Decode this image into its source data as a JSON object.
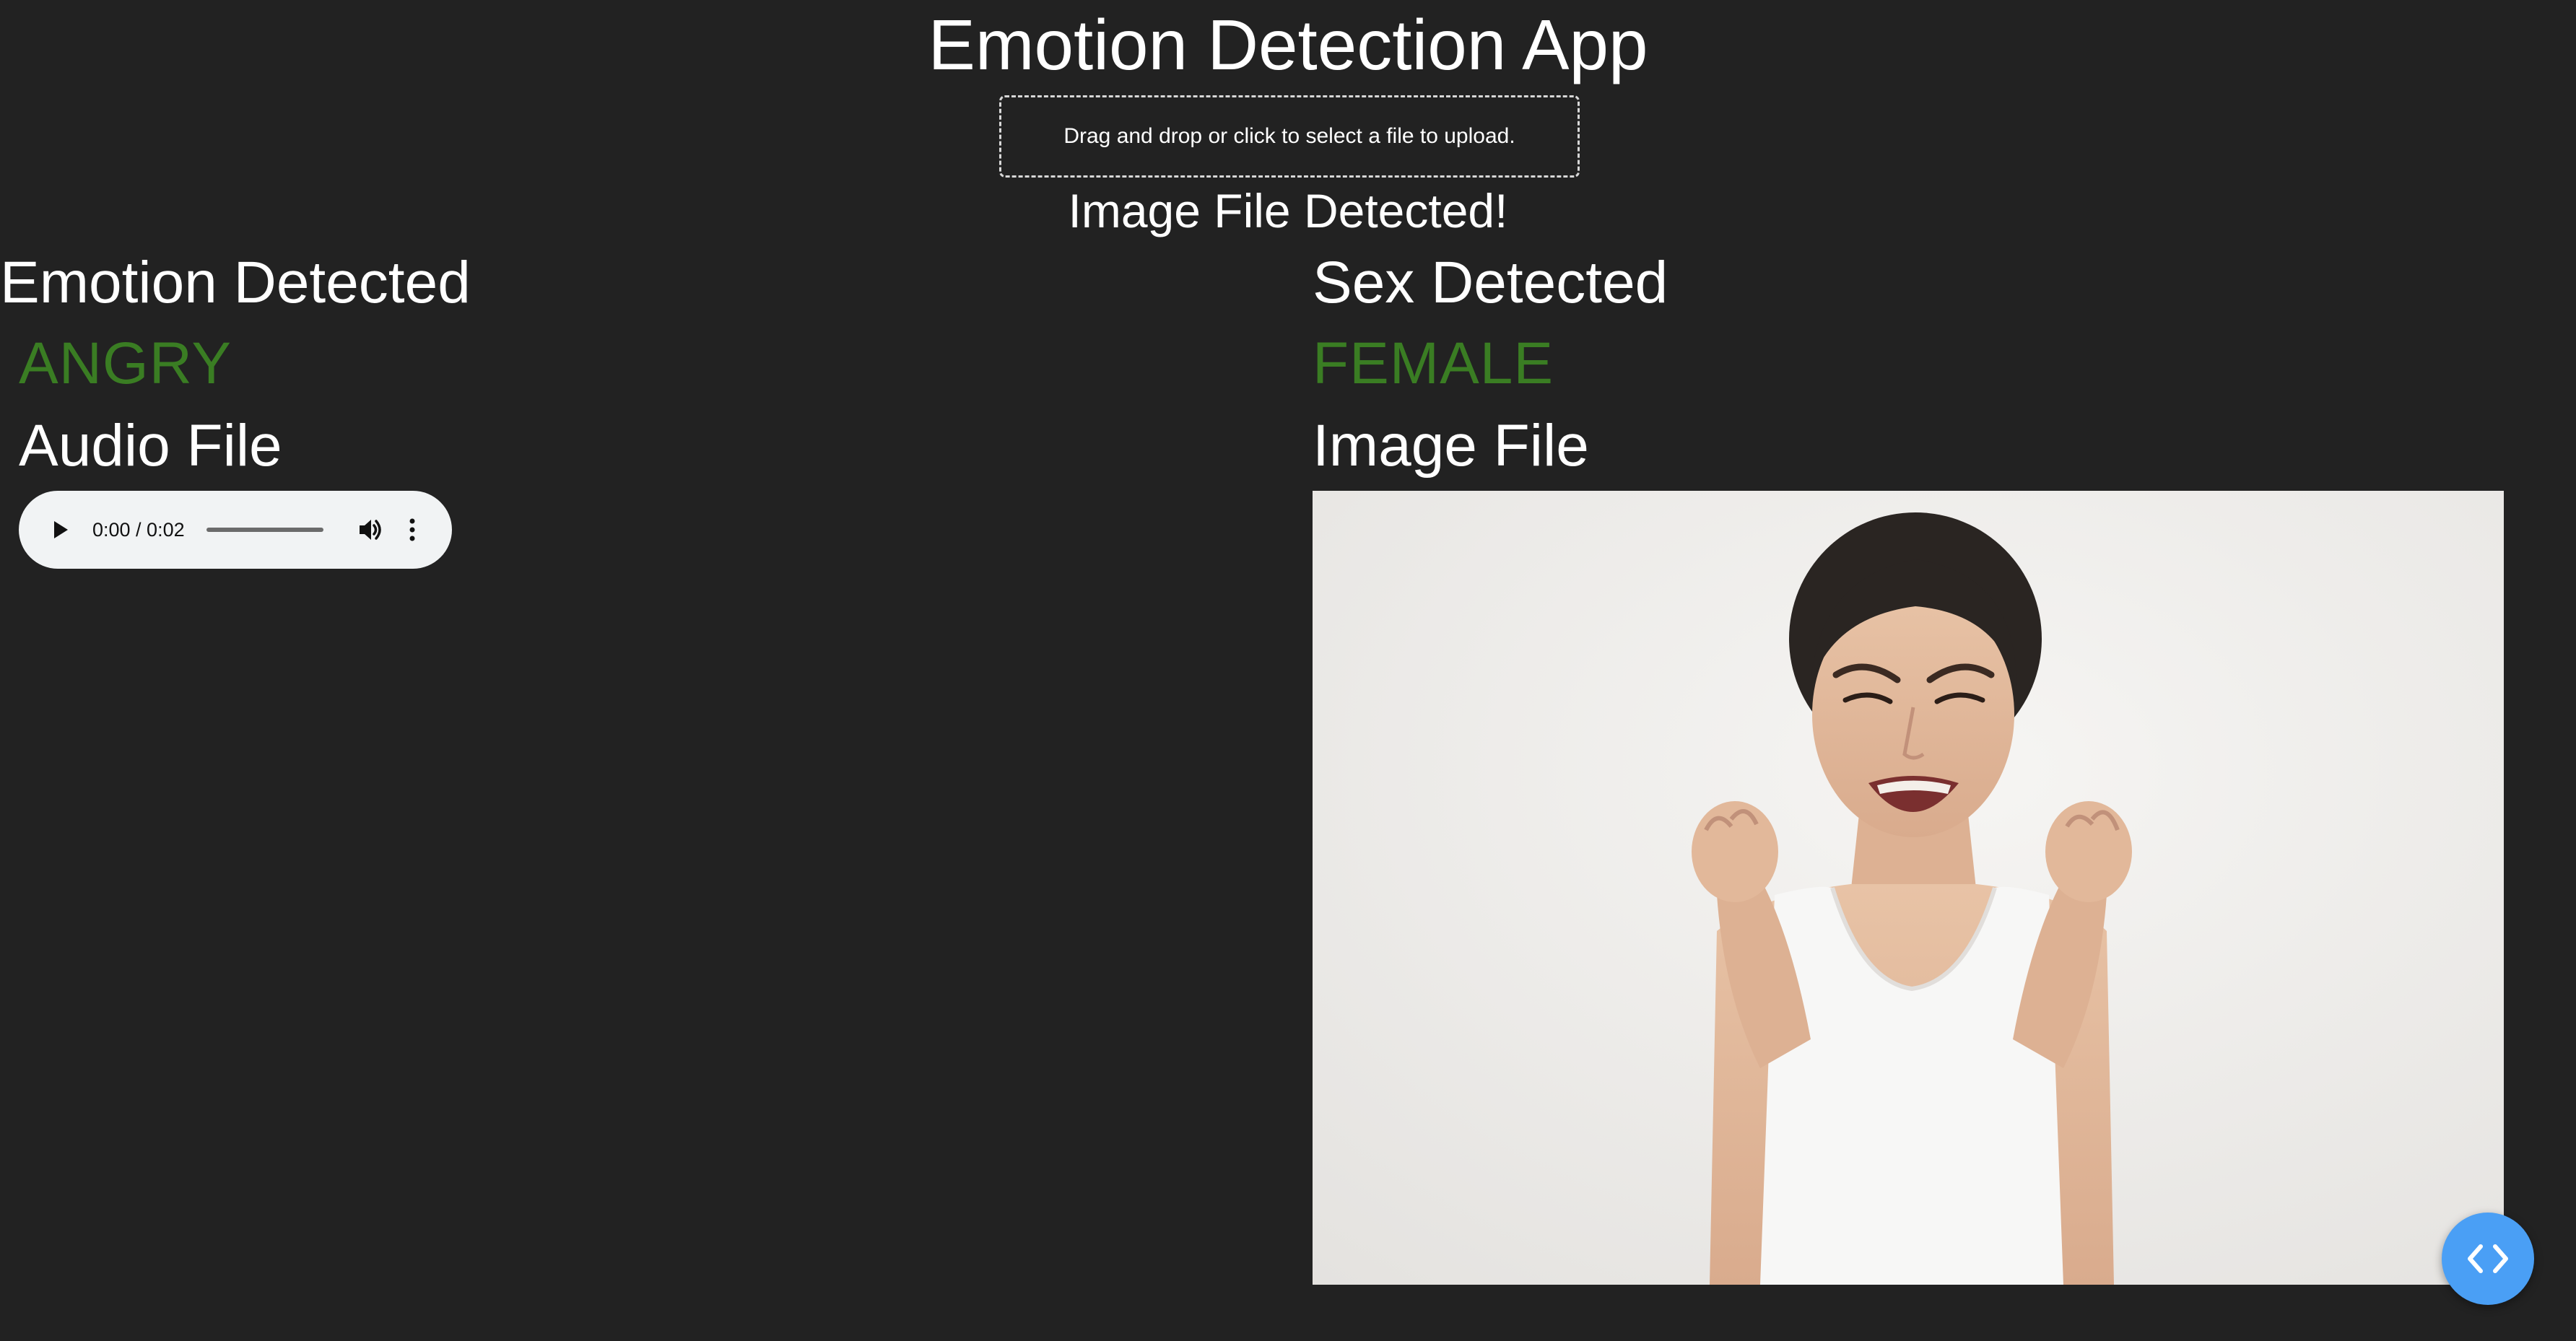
{
  "app": {
    "title": "Emotion Detection App"
  },
  "upload": {
    "prompt": "Drag and drop or click to select a file to upload."
  },
  "status": {
    "message": "Image File Detected!"
  },
  "emotion": {
    "heading": "Emotion Detected",
    "value": "ANGRY"
  },
  "sex": {
    "heading": "Sex Detected",
    "value": "FEMALE"
  },
  "audio": {
    "heading": "Audio File",
    "time": "0:00 / 0:02",
    "progress": 0,
    "icons": [
      "play-icon",
      "volume-icon",
      "more-vertical-icon"
    ]
  },
  "image": {
    "heading": "Image File",
    "subject": "woman with clenched fists and angry expression"
  },
  "fab": {
    "icon": "code-brackets-icon"
  },
  "colors": {
    "background": "#222222",
    "text": "#ffffff",
    "result": "#3a7d23",
    "player_bg": "#f1f3f4",
    "fab": "#4a9ff5"
  }
}
